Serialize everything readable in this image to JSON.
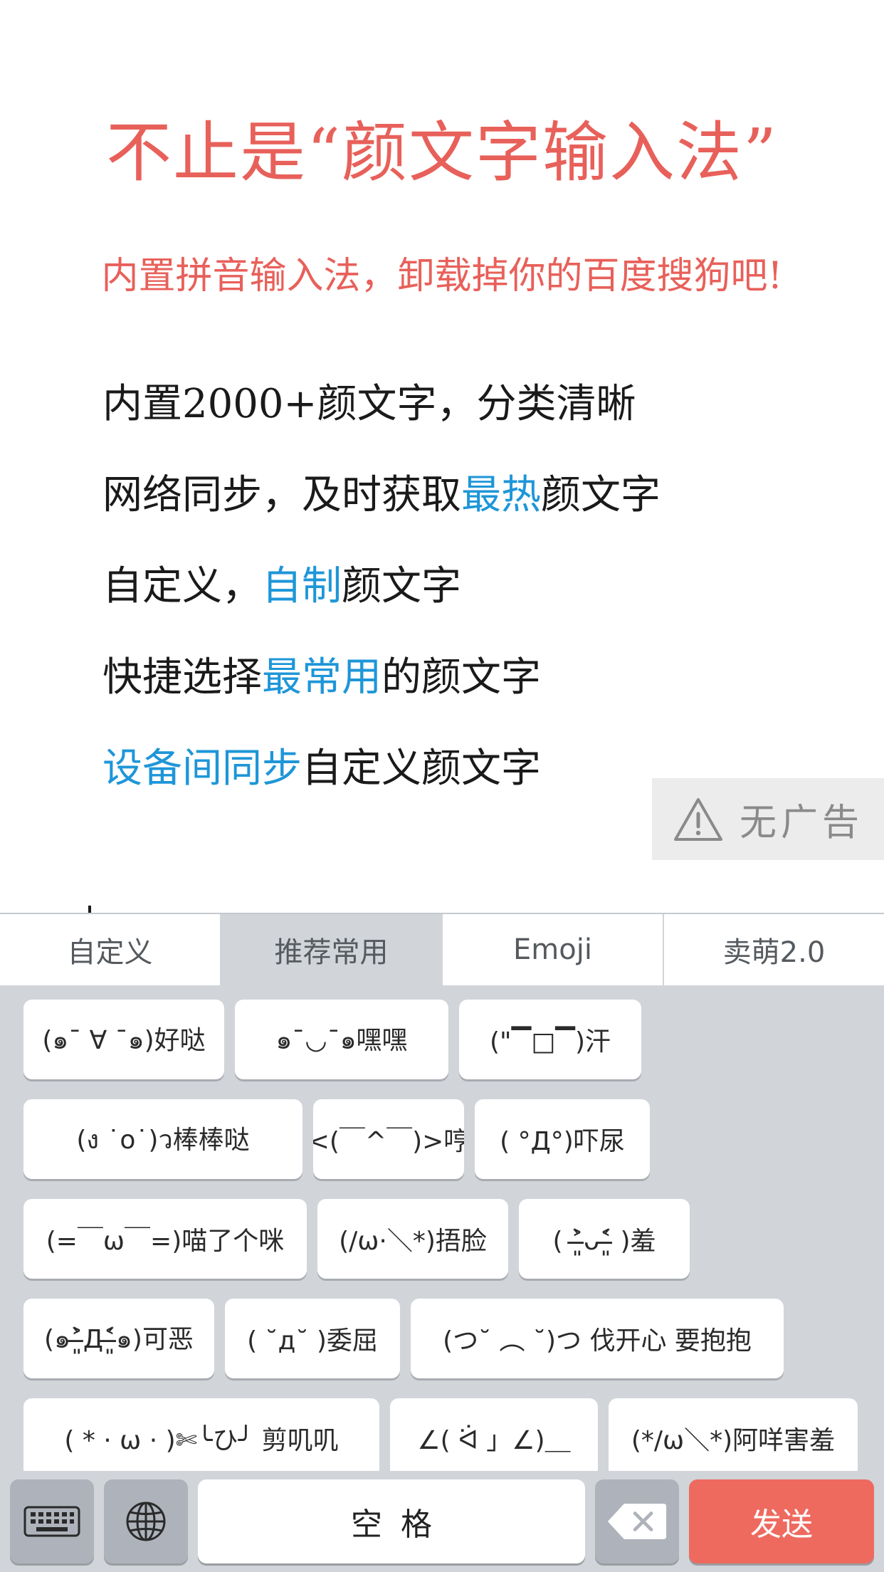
{
  "promo": {
    "headline": "不止是“颜文字输入法”",
    "subhead": "内置拼音输入法，卸载掉你的百度搜狗吧!",
    "features": [
      {
        "parts": [
          {
            "text": "内置2000+颜文字，分类清晰",
            "hl": false
          }
        ]
      },
      {
        "parts": [
          {
            "text": "网络同步，及时获取",
            "hl": false
          },
          {
            "text": "最热",
            "hl": true
          },
          {
            "text": "颜文字",
            "hl": false
          }
        ]
      },
      {
        "parts": [
          {
            "text": "自定义，",
            "hl": false
          },
          {
            "text": "自制",
            "hl": true
          },
          {
            "text": "颜文字",
            "hl": false
          }
        ]
      },
      {
        "parts": [
          {
            "text": "快捷选择",
            "hl": false
          },
          {
            "text": "最常用",
            "hl": true
          },
          {
            "text": "的颜文字",
            "hl": false
          }
        ]
      },
      {
        "parts": [
          {
            "text": "设备间同步",
            "hl": true
          },
          {
            "text": "自定义颜文字",
            "hl": false
          }
        ]
      }
    ],
    "no_ads": {
      "label": "无广告",
      "icon": "warning-triangle-icon"
    }
  },
  "keyboard": {
    "tabs": [
      {
        "label": "自定义",
        "active": false
      },
      {
        "label": "推荐常用",
        "active": true
      },
      {
        "label": "Emoji",
        "active": false
      },
      {
        "label": "卖萌2.0",
        "active": false
      }
    ],
    "rows": [
      [
        "(๑¯ ∀ ¯๑)好哒",
        "๑¯◡¯๑嘿嘿",
        "(\"▔□▔)汗"
      ],
      [
        "(ง ˙o˙)ว棒棒哒",
        "<(￣^￣)>哼",
        "( °Д°)吓尿"
      ],
      [
        "(=￣ω￣=)喵了个咪",
        "(/ω·＼*)捂脸",
        "(  ˃̶͈̀ᴗ˂̶͈́  )羞"
      ],
      [
        "(๑˃̶͈̀Д˂̶͈́๑)可恶",
        "( ˘д˘ )委屈",
        "(つ˘ ︵ ˘)つ 伐开心 要抱抱"
      ],
      [
        "( * · ω · )✄╰ひ╯ 剪叽叽",
        "∠( ᐛ 」∠)＿",
        "(*/ω＼*)阿咩害羞"
      ]
    ],
    "bottom": {
      "keyboard_icon": "keyboard-icon",
      "globe_icon": "globe-icon",
      "space_label": "空格",
      "delete_icon": "backspace-icon",
      "send_label": "发送"
    },
    "colors": {
      "accent_red": "#e8605a",
      "highlight_blue": "#1e96d8",
      "send_bg": "#ee6a5f",
      "keyboard_bg": "#d1d4d9"
    }
  }
}
